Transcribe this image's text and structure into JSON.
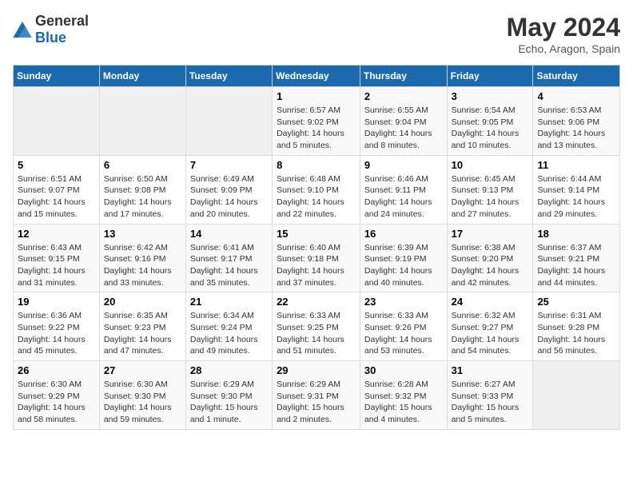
{
  "header": {
    "logo_general": "General",
    "logo_blue": "Blue",
    "title": "May 2024",
    "subtitle": "Echo, Aragon, Spain"
  },
  "days_of_week": [
    "Sunday",
    "Monday",
    "Tuesday",
    "Wednesday",
    "Thursday",
    "Friday",
    "Saturday"
  ],
  "weeks": [
    [
      {
        "num": "",
        "info": ""
      },
      {
        "num": "",
        "info": ""
      },
      {
        "num": "",
        "info": ""
      },
      {
        "num": "1",
        "info": "Sunrise: 6:57 AM\nSunset: 9:02 PM\nDaylight: 14 hours\nand 5 minutes."
      },
      {
        "num": "2",
        "info": "Sunrise: 6:55 AM\nSunset: 9:04 PM\nDaylight: 14 hours\nand 8 minutes."
      },
      {
        "num": "3",
        "info": "Sunrise: 6:54 AM\nSunset: 9:05 PM\nDaylight: 14 hours\nand 10 minutes."
      },
      {
        "num": "4",
        "info": "Sunrise: 6:53 AM\nSunset: 9:06 PM\nDaylight: 14 hours\nand 13 minutes."
      }
    ],
    [
      {
        "num": "5",
        "info": "Sunrise: 6:51 AM\nSunset: 9:07 PM\nDaylight: 14 hours\nand 15 minutes."
      },
      {
        "num": "6",
        "info": "Sunrise: 6:50 AM\nSunset: 9:08 PM\nDaylight: 14 hours\nand 17 minutes."
      },
      {
        "num": "7",
        "info": "Sunrise: 6:49 AM\nSunset: 9:09 PM\nDaylight: 14 hours\nand 20 minutes."
      },
      {
        "num": "8",
        "info": "Sunrise: 6:48 AM\nSunset: 9:10 PM\nDaylight: 14 hours\nand 22 minutes."
      },
      {
        "num": "9",
        "info": "Sunrise: 6:46 AM\nSunset: 9:11 PM\nDaylight: 14 hours\nand 24 minutes."
      },
      {
        "num": "10",
        "info": "Sunrise: 6:45 AM\nSunset: 9:13 PM\nDaylight: 14 hours\nand 27 minutes."
      },
      {
        "num": "11",
        "info": "Sunrise: 6:44 AM\nSunset: 9:14 PM\nDaylight: 14 hours\nand 29 minutes."
      }
    ],
    [
      {
        "num": "12",
        "info": "Sunrise: 6:43 AM\nSunset: 9:15 PM\nDaylight: 14 hours\nand 31 minutes."
      },
      {
        "num": "13",
        "info": "Sunrise: 6:42 AM\nSunset: 9:16 PM\nDaylight: 14 hours\nand 33 minutes."
      },
      {
        "num": "14",
        "info": "Sunrise: 6:41 AM\nSunset: 9:17 PM\nDaylight: 14 hours\nand 35 minutes."
      },
      {
        "num": "15",
        "info": "Sunrise: 6:40 AM\nSunset: 9:18 PM\nDaylight: 14 hours\nand 37 minutes."
      },
      {
        "num": "16",
        "info": "Sunrise: 6:39 AM\nSunset: 9:19 PM\nDaylight: 14 hours\nand 40 minutes."
      },
      {
        "num": "17",
        "info": "Sunrise: 6:38 AM\nSunset: 9:20 PM\nDaylight: 14 hours\nand 42 minutes."
      },
      {
        "num": "18",
        "info": "Sunrise: 6:37 AM\nSunset: 9:21 PM\nDaylight: 14 hours\nand 44 minutes."
      }
    ],
    [
      {
        "num": "19",
        "info": "Sunrise: 6:36 AM\nSunset: 9:22 PM\nDaylight: 14 hours\nand 45 minutes."
      },
      {
        "num": "20",
        "info": "Sunrise: 6:35 AM\nSunset: 9:23 PM\nDaylight: 14 hours\nand 47 minutes."
      },
      {
        "num": "21",
        "info": "Sunrise: 6:34 AM\nSunset: 9:24 PM\nDaylight: 14 hours\nand 49 minutes."
      },
      {
        "num": "22",
        "info": "Sunrise: 6:33 AM\nSunset: 9:25 PM\nDaylight: 14 hours\nand 51 minutes."
      },
      {
        "num": "23",
        "info": "Sunrise: 6:33 AM\nSunset: 9:26 PM\nDaylight: 14 hours\nand 53 minutes."
      },
      {
        "num": "24",
        "info": "Sunrise: 6:32 AM\nSunset: 9:27 PM\nDaylight: 14 hours\nand 54 minutes."
      },
      {
        "num": "25",
        "info": "Sunrise: 6:31 AM\nSunset: 9:28 PM\nDaylight: 14 hours\nand 56 minutes."
      }
    ],
    [
      {
        "num": "26",
        "info": "Sunrise: 6:30 AM\nSunset: 9:29 PM\nDaylight: 14 hours\nand 58 minutes."
      },
      {
        "num": "27",
        "info": "Sunrise: 6:30 AM\nSunset: 9:30 PM\nDaylight: 14 hours\nand 59 minutes."
      },
      {
        "num": "28",
        "info": "Sunrise: 6:29 AM\nSunset: 9:30 PM\nDaylight: 15 hours\nand 1 minute."
      },
      {
        "num": "29",
        "info": "Sunrise: 6:29 AM\nSunset: 9:31 PM\nDaylight: 15 hours\nand 2 minutes."
      },
      {
        "num": "30",
        "info": "Sunrise: 6:28 AM\nSunset: 9:32 PM\nDaylight: 15 hours\nand 4 minutes."
      },
      {
        "num": "31",
        "info": "Sunrise: 6:27 AM\nSunset: 9:33 PM\nDaylight: 15 hours\nand 5 minutes."
      },
      {
        "num": "",
        "info": ""
      }
    ]
  ]
}
